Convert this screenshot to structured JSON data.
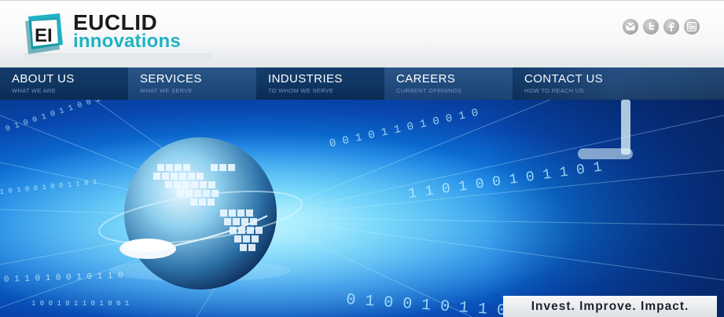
{
  "brand": {
    "mark_text": "EI",
    "line1": "EUCLID",
    "line2": "innovations",
    "colors": {
      "dark": "#1b1b1b",
      "teal": "#1fb3c4"
    }
  },
  "social": [
    {
      "icon": "email-icon"
    },
    {
      "icon": "twitter-icon"
    },
    {
      "icon": "facebook-icon"
    },
    {
      "icon": "linkedin-icon"
    }
  ],
  "nav": {
    "items": [
      {
        "label": "ABOUT US",
        "sub": "WHAT WE ARE"
      },
      {
        "label": "SERVICES",
        "sub": "WHAT WE SERVE"
      },
      {
        "label": "INDUSTRIES",
        "sub": "TO WHOM WE SERVE"
      },
      {
        "label": "CAREERS",
        "sub": "CURRENT OPENINGS"
      },
      {
        "label": "CONTACT US",
        "sub": "HOW TO REACH US"
      }
    ]
  },
  "hero": {
    "tagline": "Invest. Improve. Impact.",
    "binary_rows": [
      "0 1 0 0 1 0 1 1 0 0 1 0",
      "1 0 1 0 0 1 0 0 1 1 0 1",
      "0 1 1 0 1 0 0 1 0 1 1 0",
      "1 0 0 1 0 1 1 0 1 0 0 1",
      "0 0 1 0 1 1 0 1 0 0 1 0",
      "1 1 0 1 0 0 1 0 1 1 0 1"
    ]
  }
}
